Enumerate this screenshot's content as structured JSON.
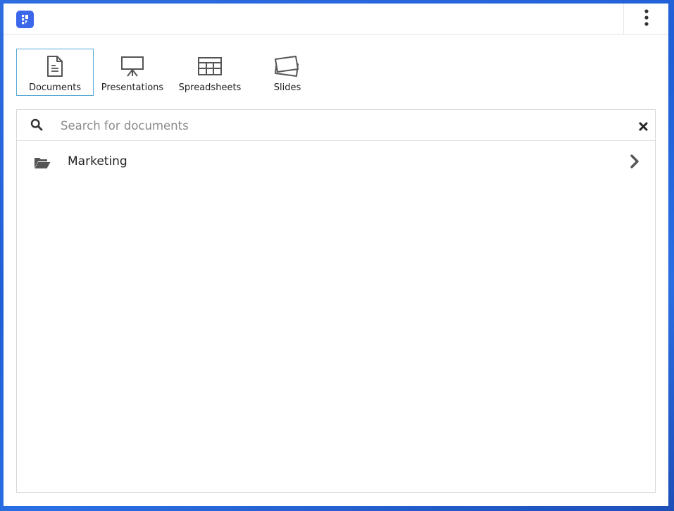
{
  "app": {
    "logo_icon": "app-logo-icon",
    "menu_icon": "more-vertical-icon",
    "accent_color": "#3b67ea"
  },
  "tabs": [
    {
      "label": "Documents",
      "icon": "document-icon",
      "active": true
    },
    {
      "label": "Presentations",
      "icon": "presentation-icon",
      "active": false
    },
    {
      "label": "Spreadsheets",
      "icon": "spreadsheet-icon",
      "active": false
    },
    {
      "label": "Slides",
      "icon": "slides-icon",
      "active": false
    }
  ],
  "search": {
    "placeholder": "Search for documents",
    "value": "",
    "search_icon": "search-icon",
    "clear_icon": "close-icon"
  },
  "list": {
    "items": [
      {
        "label": "Marketing",
        "icon": "folder-open-icon",
        "trailing_icon": "chevron-right-icon"
      }
    ]
  }
}
